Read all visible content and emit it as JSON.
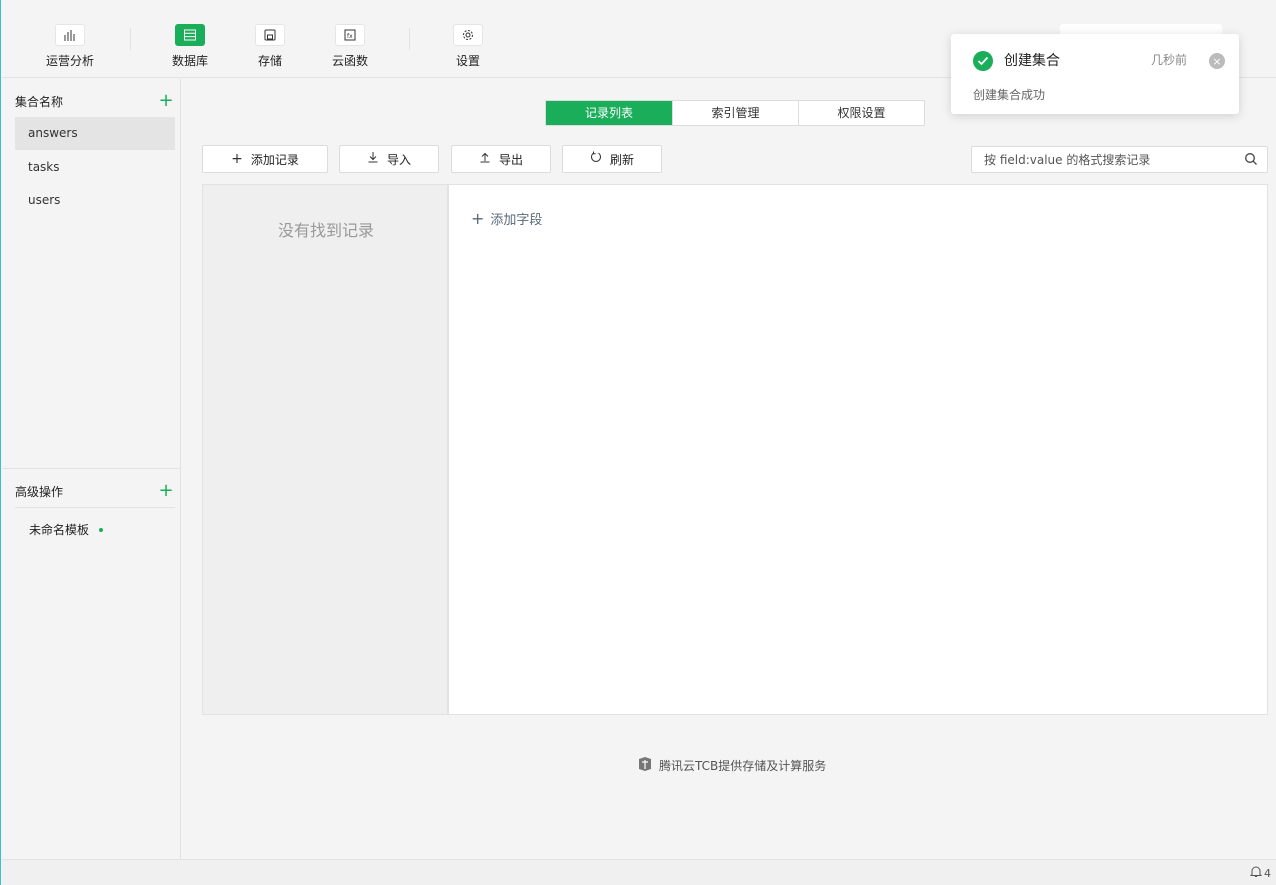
{
  "toolbar": {
    "items": [
      {
        "label": "运营分析",
        "icon": "analytics-icon"
      },
      {
        "label": "数据库",
        "icon": "database-icon",
        "active": true
      },
      {
        "label": "存储",
        "icon": "storage-icon"
      },
      {
        "label": "云函数",
        "icon": "cloud-function-icon"
      },
      {
        "label": "设置",
        "icon": "gear-icon"
      }
    ]
  },
  "sidebar": {
    "collections_header": "集合名称",
    "collections": [
      "answers",
      "tasks",
      "users"
    ],
    "selected_collection": "answers",
    "advanced_header": "高级操作",
    "template_item": "未命名模板"
  },
  "tabs": [
    "记录列表",
    "索引管理",
    "权限设置"
  ],
  "actions": {
    "add_record": "添加记录",
    "import": "导入",
    "export": "导出",
    "refresh": "刷新"
  },
  "search": {
    "placeholder": "按 field:value 的格式搜索记录"
  },
  "records": {
    "empty_message": "没有找到记录"
  },
  "detail": {
    "add_field": "添加字段"
  },
  "footer": {
    "note": "腾讯云TCB提供存储及计算服务"
  },
  "status": {
    "notification_count": "4"
  },
  "toast": {
    "title": "创建集合",
    "time": "几秒前",
    "body": "创建集合成功"
  },
  "colors": {
    "accent": "#1aad5a",
    "frame": "#39c0d0"
  }
}
